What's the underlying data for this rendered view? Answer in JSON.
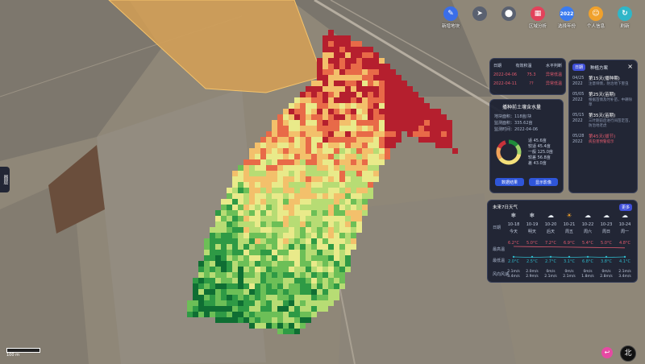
{
  "toolbar": {
    "items": [
      {
        "label": "新增地块",
        "icon": "edit-tools-icon",
        "color": "#3a6ee8",
        "glyph": "✎"
      },
      {
        "label": "",
        "icon": "navigate-icon",
        "color": "#5a6170",
        "glyph": "➤"
      },
      {
        "label": "",
        "icon": "location-pin-icon",
        "color": "#5a6170",
        "glyph": "⬤"
      },
      {
        "label": "区域分析",
        "icon": "grid-analysis-icon",
        "color": "#e2425b",
        "glyph": "▦"
      },
      {
        "label": "选择年份",
        "icon": "year-calendar-icon",
        "color": "#3a7bf0",
        "glyph": "2022"
      },
      {
        "label": "个人信息",
        "icon": "user-icon",
        "color": "#f0a12c",
        "glyph": "☺"
      },
      {
        "label": "刷新",
        "icon": "refresh-icon",
        "color": "#2fb6c8",
        "glyph": "↻"
      }
    ]
  },
  "date_panel": {
    "headers": [
      "日期",
      "有效积温",
      "水平判断"
    ],
    "rows": [
      [
        "2022-04-06",
        "75.3",
        "异常低温"
      ],
      [
        "2022-04-11",
        "??",
        "异常低温"
      ]
    ]
  },
  "soil_panel": {
    "title": "播种前土壤含水量",
    "lines": [
      "地块面积：118亩/块",
      "监测面积：335.62亩",
      "监测时间：2022-04-06"
    ],
    "legend": [
      "适 45.6亩",
      "较适 45.4亩",
      "一般 125.0亩",
      "较差 56.8亩",
      "差 43.0亩"
    ],
    "buttons": [
      "数据结果",
      "显示影像"
    ],
    "colors": [
      "#1f8a3a",
      "#9fd36a",
      "#f4e07a",
      "#f0a25a",
      "#c8323a"
    ],
    "fractions": [
      0.14,
      0.14,
      0.37,
      0.17,
      0.13
    ]
  },
  "plan_panel": {
    "badge": "日期",
    "title": "种植方案",
    "close": "×",
    "items": [
      {
        "date": "04/25 2022",
        "t": "第15天(播种期)",
        "d": "注意墒情，防治地下害虫",
        "alert": false
      },
      {
        "date": "05/05 2022",
        "t": "第25天(苗期)",
        "d": "根据苗情及时补苗，中耕除草",
        "alert": false
      },
      {
        "date": "05/15 2022",
        "t": "第35天(苗期)",
        "d": "三叶期前后进行间苗定苗，防治地老虎",
        "alert": false
      },
      {
        "date": "05/28 2022",
        "t": "第45天(拔节)",
        "d": "病虫害预警提示",
        "alert": true
      }
    ]
  },
  "weather_panel": {
    "title": "未来7日天气",
    "badge": "更多",
    "row_labels": {
      "date": "日期",
      "high": "最高温",
      "low": "最低温",
      "wind": "风向风速"
    },
    "days": [
      {
        "icon": "rain-snow-icon",
        "glyph": "❄",
        "date": "10-18",
        "dow": "今天",
        "high": "6.2°C",
        "low": "2.0°C",
        "wind": "2.1m/s 3.4m/s"
      },
      {
        "icon": "rain-snow-icon",
        "glyph": "❄",
        "date": "10-19",
        "dow": "明天",
        "high": "5.0°C",
        "low": "2.5°C",
        "wind": "2.0m/s 2.9m/s"
      },
      {
        "icon": "cloud-icon",
        "glyph": "☁",
        "date": "10-20",
        "dow": "后天",
        "high": "7.2°C",
        "low": "2.7°C",
        "wind": "0m/s 2.1m/s"
      },
      {
        "icon": "sun-icon",
        "glyph": "☀",
        "date": "10-21",
        "dow": "周五",
        "high": "6.9°C",
        "low": "3.1°C",
        "wind": "0m/s 2.1m/s"
      },
      {
        "icon": "cloud-icon",
        "glyph": "☁",
        "date": "10-22",
        "dow": "周六",
        "high": "5.4°C",
        "low": "6.8°C",
        "wind": "0m/s 1.8m/s"
      },
      {
        "icon": "cloud-icon",
        "glyph": "☁",
        "date": "10-23",
        "dow": "周日",
        "high": "5.0°C",
        "low": "3.8°C",
        "wind": "0m/s 2.8m/s"
      },
      {
        "icon": "cloud-icon",
        "glyph": "☁",
        "date": "10-24",
        "dow": "周一",
        "high": "4.8°C",
        "low": "4.1°C",
        "wind": "2.1m/s 3.4m/s"
      }
    ]
  },
  "scale_label": "100 m",
  "side_tab": "图层",
  "north": "北",
  "back": "↩"
}
